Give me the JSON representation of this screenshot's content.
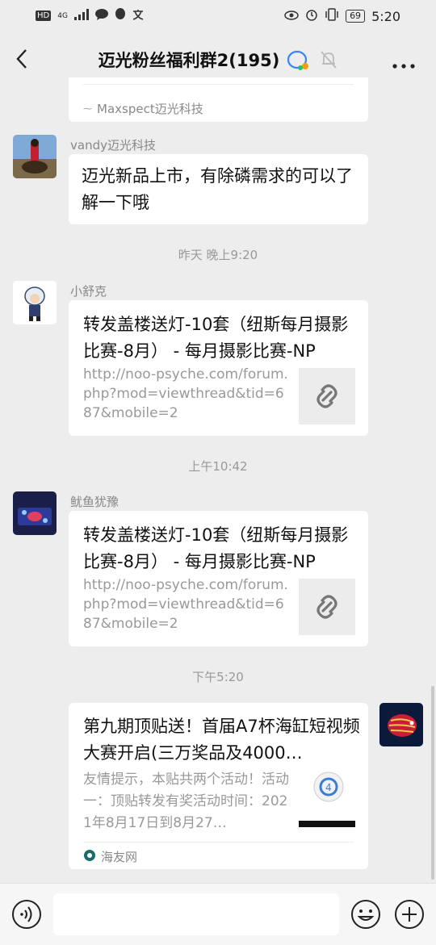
{
  "status": {
    "network": "4G",
    "battery": "69",
    "time": "5:20"
  },
  "header": {
    "title": "迈光粉丝福利群2(195)"
  },
  "messages": {
    "partial_source": "Maxspect迈光科技",
    "m1": {
      "sender": "vandy迈光科技",
      "text": "迈光新品上市，有除磷需求的可以了解一下哦"
    },
    "ts1": "昨天 晚上9:20",
    "m2": {
      "sender": "小舒克",
      "title": "转发盖楼送灯-10套（纽斯每月摄影比赛-8月） - 每月摄影比赛-NP",
      "desc": "http://noo-psyche.com/forum.php?mod=viewthread&tid=687&mobile=2"
    },
    "ts2": "上午10:42",
    "m3": {
      "sender": "鱿鱼犹豫",
      "title": "转发盖楼送灯-10套（纽斯每月摄影比赛-8月） - 每月摄影比赛-NP",
      "desc": "http://noo-psyche.com/forum.php?mod=viewthread&tid=687&mobile=2"
    },
    "ts3": "下午5:20",
    "m4": {
      "title": "第九期顶贴送！首届A7杯海缸短视频大赛开启(三万奖品及4000…",
      "desc": "友情提示，本贴共两个活动！活动一：顶贴转发有奖活动时间：2021年8月17日到8月27…",
      "source": "海友网"
    }
  },
  "icons": {
    "back": "chevron-left-icon",
    "more": "more-dots-icon",
    "link": "link-icon",
    "voice": "voice-icon",
    "emoji": "emoji-icon",
    "add": "plus-icon"
  }
}
